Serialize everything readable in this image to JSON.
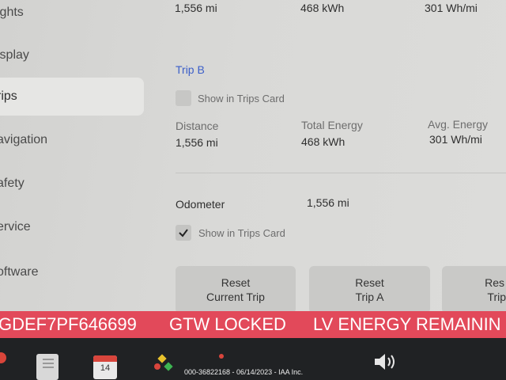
{
  "sidebar": {
    "items": [
      {
        "label": "ights"
      },
      {
        "label": "isplay"
      },
      {
        "label": "rips",
        "active": true
      },
      {
        "label": "avigation"
      },
      {
        "label": "afety"
      },
      {
        "label": "ervice"
      },
      {
        "label": "oftware"
      }
    ]
  },
  "top_stats": {
    "distance": "1,556 mi",
    "energy": "468 kWh",
    "avg": "301 Wh/mi"
  },
  "trip_b": {
    "title": "Trip B",
    "checkbox_label": "Show in Trips Card",
    "distance_label": "Distance",
    "distance_value": "1,556 mi",
    "energy_label": "Total Energy",
    "energy_value": "468 kWh",
    "avg_label": "Avg. Energy",
    "avg_value": "301 Wh/mi"
  },
  "odometer": {
    "label": "Odometer",
    "value": "1,556 mi",
    "checkbox_label": "Show in Trips Card",
    "checked": true
  },
  "buttons": {
    "reset_current_line1": "Reset",
    "reset_current_line2": "Current Trip",
    "reset_a_line1": "Reset",
    "reset_a_line2": "Trip A",
    "reset_b_line1": "Res",
    "reset_b_line2": "Trip"
  },
  "alert": {
    "vin": "GDEF7PF646699",
    "msg1": "GTW LOCKED",
    "msg2": "LV ENERGY REMAININ",
    "color": "#e2495a"
  },
  "taskbar": {
    "calendar_day": "14",
    "icons": [
      "sd-card-icon",
      "calendar-icon",
      "apps-icon",
      "volume-icon"
    ]
  },
  "watermark": "000-36822168 - 06/14/2023 - IAA Inc."
}
